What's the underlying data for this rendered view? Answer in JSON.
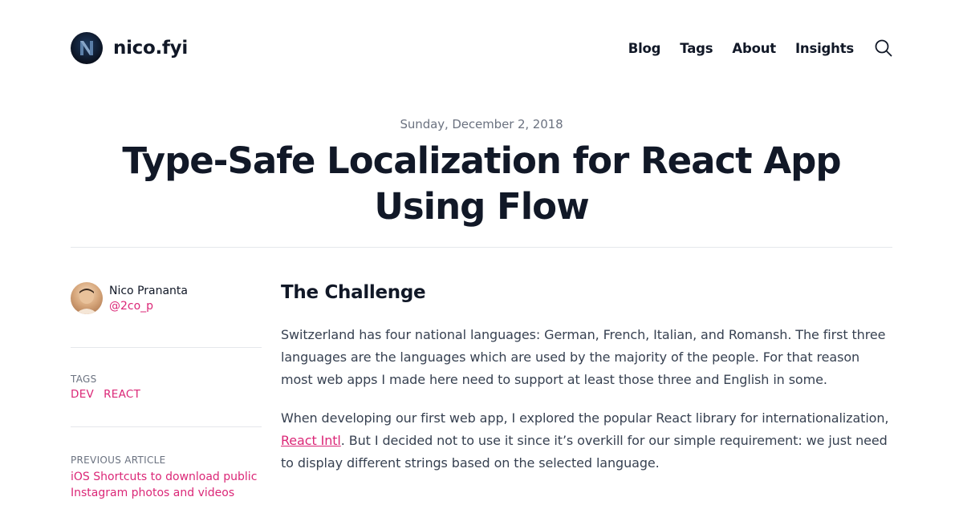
{
  "header": {
    "site_name": "nico.fyi",
    "nav": [
      "Blog",
      "Tags",
      "About",
      "Insights"
    ]
  },
  "post": {
    "date": "Sunday, December 2, 2018",
    "title": "Type-Safe Localization for React App Using Flow"
  },
  "sidebar": {
    "author_name": "Nico Prananta",
    "author_handle": "@2co_p",
    "tags_label": "TAGS",
    "tags": [
      "DEV",
      "REACT"
    ],
    "previous_label": "PREVIOUS ARTICLE",
    "previous_title": "iOS Shortcuts to download public Instagram photos and videos"
  },
  "content": {
    "heading": "The Challenge",
    "p1": "Switzerland has four national languages: German, French, Italian, and Romansh. The first three languages are the languages which are used by the majority of the people. For that reason most web apps I made here need to support at least those three and English in some.",
    "p2_before": "When developing our first web app, I explored the popular React library for internationalization, ",
    "p2_link": "React Intl",
    "p2_after": ". But I decided not to use it since it’s overkill for our simple requirement: we just need to display different strings based on the selected language."
  },
  "colors": {
    "accent": "#db2777",
    "text": "#111827",
    "muted": "#6b7280"
  }
}
